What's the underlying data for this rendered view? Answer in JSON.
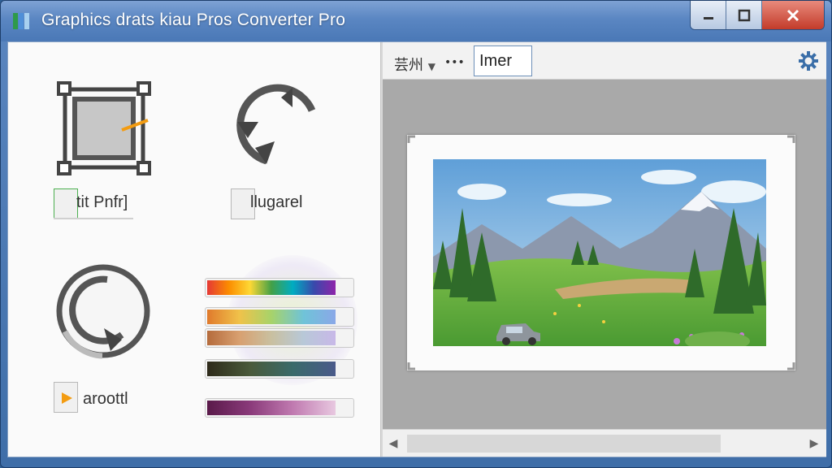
{
  "window": {
    "title": "Graphics drats kiau Pros Converter Pro"
  },
  "tools": [
    {
      "label": "tit Pnfr]",
      "icon": "crop-icon"
    },
    {
      "label": "llugarel",
      "icon": "rotate-icon"
    },
    {
      "label": "aroottl",
      "icon": "redo-icon"
    }
  ],
  "toolbar": {
    "menu_label": "芸州",
    "more_label": "•••",
    "input_value": "Imer"
  },
  "colors": {
    "accent": "#3c78c8",
    "check_green": "#4caf50",
    "orange": "#f39c12"
  }
}
